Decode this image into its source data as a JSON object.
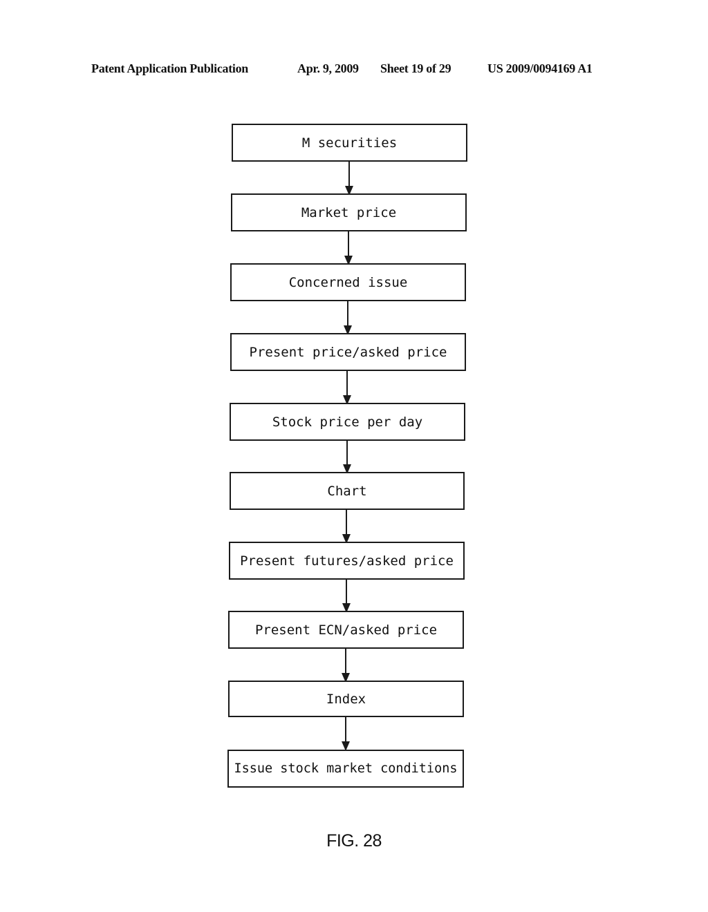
{
  "header": {
    "publication": "Patent Application Publication",
    "date": "Apr. 9, 2009",
    "sheet": "Sheet 19 of 29",
    "number": "US 2009/0094169 A1"
  },
  "flowchart": {
    "steps": [
      {
        "label": "M securities"
      },
      {
        "label": "Market price"
      },
      {
        "label": "Concerned issue"
      },
      {
        "label": "Present price/asked price"
      },
      {
        "label": "Stock price per day"
      },
      {
        "label": "Chart"
      },
      {
        "label": "Present futures/asked price"
      },
      {
        "label": "Present ECN/asked price"
      },
      {
        "label": "Index"
      },
      {
        "label": "Issue stock market conditions"
      }
    ]
  },
  "figure_label": "FIG. 28"
}
